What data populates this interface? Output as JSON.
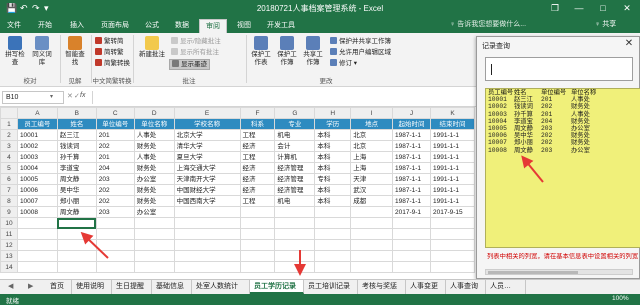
{
  "window": {
    "title": "20180721人事档案管理系统 - Excel",
    "restore_label": "❐",
    "minimize_label": "—",
    "maximize_label": "□",
    "close_label": "✕",
    "qa_save": "💾",
    "qa_undo": "↶",
    "qa_redo": "↷",
    "qa_more": "▾"
  },
  "tabs": {
    "items": [
      "文件",
      "开始",
      "插入",
      "页面布局",
      "公式",
      "数据",
      "审阅",
      "视图",
      "开发工具"
    ],
    "active": "审阅",
    "help_placeholder": "♀ 告诉我您想要做什么...",
    "share_label": "♀ 共享"
  },
  "ribbon": {
    "groups": {
      "proofing": "校对",
      "insights": "见解",
      "language": "中文简繁转换",
      "comments": "批注",
      "changes": "更改"
    },
    "buttons": {
      "spelling": "拼写检查",
      "thesaurus": "同义词库",
      "smart_lookup": "智能查找",
      "new_comment": "新建批注",
      "protect_sheet": "保护工作表",
      "protect_workbook": "保护工作簿",
      "share_workbook": "共享工作簿"
    },
    "small": {
      "trad_to_simp": "繁转简",
      "simp_to_trad": "简转繁",
      "convert": "简繁转换",
      "show_hide_comment": "显示/隐藏批注",
      "show_all_comments": "显示所有批注",
      "show_ink": "显示墨迹",
      "protect_share": "保护并共享工作簿",
      "allow_edit_ranges": "允许用户编辑区域",
      "track_changes": "修订 ▾"
    }
  },
  "formula_bar": {
    "namebox": "B10",
    "fx": "fx",
    "cancel": "✕",
    "enter": "✓"
  },
  "grid": {
    "columns": [
      "A",
      "B",
      "C",
      "D",
      "E",
      "F",
      "G",
      "H",
      "I",
      "J",
      "K"
    ],
    "row_numbers": [
      "1",
      "2",
      "3",
      "4",
      "5",
      "6",
      "7",
      "8",
      "9",
      "10",
      "11",
      "12",
      "13",
      "14"
    ],
    "header": [
      "员工编号",
      "姓名",
      "单位编号",
      "单位名称",
      "学校名称",
      "科系",
      "专业",
      "学历",
      "地点",
      "起始时间",
      "结束时间"
    ],
    "rows": [
      [
        "10001",
        "赵三江",
        "201",
        "人事处",
        "北京大学",
        "工程",
        "机电",
        "本科",
        "北京",
        "1987-1-1",
        "1991-1-1"
      ],
      [
        "10002",
        "钱读词",
        "202",
        "财务处",
        "清华大学",
        "经济",
        "会计",
        "本科",
        "北京",
        "1987-1-1",
        "1991-1-1"
      ],
      [
        "10003",
        "孙千算",
        "201",
        "人事处",
        "夏旦大学",
        "工程",
        "计算机",
        "本科",
        "上海",
        "1987-1-1",
        "1991-1-1"
      ],
      [
        "10004",
        "李道宝",
        "204",
        "财务处",
        "上海交通大学",
        "经济",
        "经济管理",
        "本科",
        "上海",
        "1987-1-1",
        "1991-1-1"
      ],
      [
        "10005",
        "周文静",
        "203",
        "办公室",
        "天津南开大学",
        "经济",
        "经济管理",
        "专科",
        "天津",
        "1987-1-1",
        "1991-1-1"
      ],
      [
        "10006",
        "吴中华",
        "202",
        "财务处",
        "中国财经大学",
        "经济",
        "经济管理",
        "本科",
        "武汉",
        "1987-1-1",
        "1991-1-1"
      ],
      [
        "10007",
        "郑小丽",
        "202",
        "财务处",
        "中国西南大学",
        "工程",
        "机电",
        "本科",
        "成都",
        "1987-1-1",
        "1991-1-1"
      ],
      [
        "10008",
        "周文静",
        "203",
        "办公室",
        "",
        "",
        "",
        "",
        "",
        "2017-9-1",
        "2017-9-15"
      ]
    ]
  },
  "sheet_tabs": {
    "items": [
      "首页",
      "使用说明",
      "生日提醒",
      "基础信息",
      "处室人数统计",
      "员工学历记录",
      "员工培训记录",
      "考核与奖惩",
      "人事变更",
      "人事查询",
      "人员…"
    ],
    "active": "员工学历记录",
    "prev_label": "◀",
    "next_label": "▶",
    "more_label": "…"
  },
  "status": {
    "ready": "就绪",
    "zoom": "100%"
  },
  "dialog": {
    "title": "记录查询",
    "close_label": "✕",
    "list_header": [
      "员工编号",
      "姓名",
      "单位编号",
      "单位名称"
    ],
    "list_rows": [
      [
        "10001",
        "赵三江",
        "201",
        "人事处"
      ],
      [
        "10002",
        "钱读词",
        "202",
        "财务处"
      ],
      [
        "10003",
        "孙千算",
        "201",
        "人事处"
      ],
      [
        "10004",
        "李道宝",
        "204",
        "财务处"
      ],
      [
        "10005",
        "周文静",
        "203",
        "办公室"
      ],
      [
        "10006",
        "吴中华",
        "202",
        "财务处"
      ],
      [
        "10007",
        "郑小丽",
        "202",
        "财务处"
      ],
      [
        "10008",
        "周文静",
        "203",
        "办公室"
      ]
    ],
    "hint": "列表中相关的列宽，请在基本信息表中设置相关的列宽"
  },
  "colors": {
    "excel_green": "#217346",
    "header_blue": "#2e8bc0",
    "list_yellow": "#f0f07a",
    "hint_red": "#d00000",
    "arrow_red": "#e53935"
  }
}
